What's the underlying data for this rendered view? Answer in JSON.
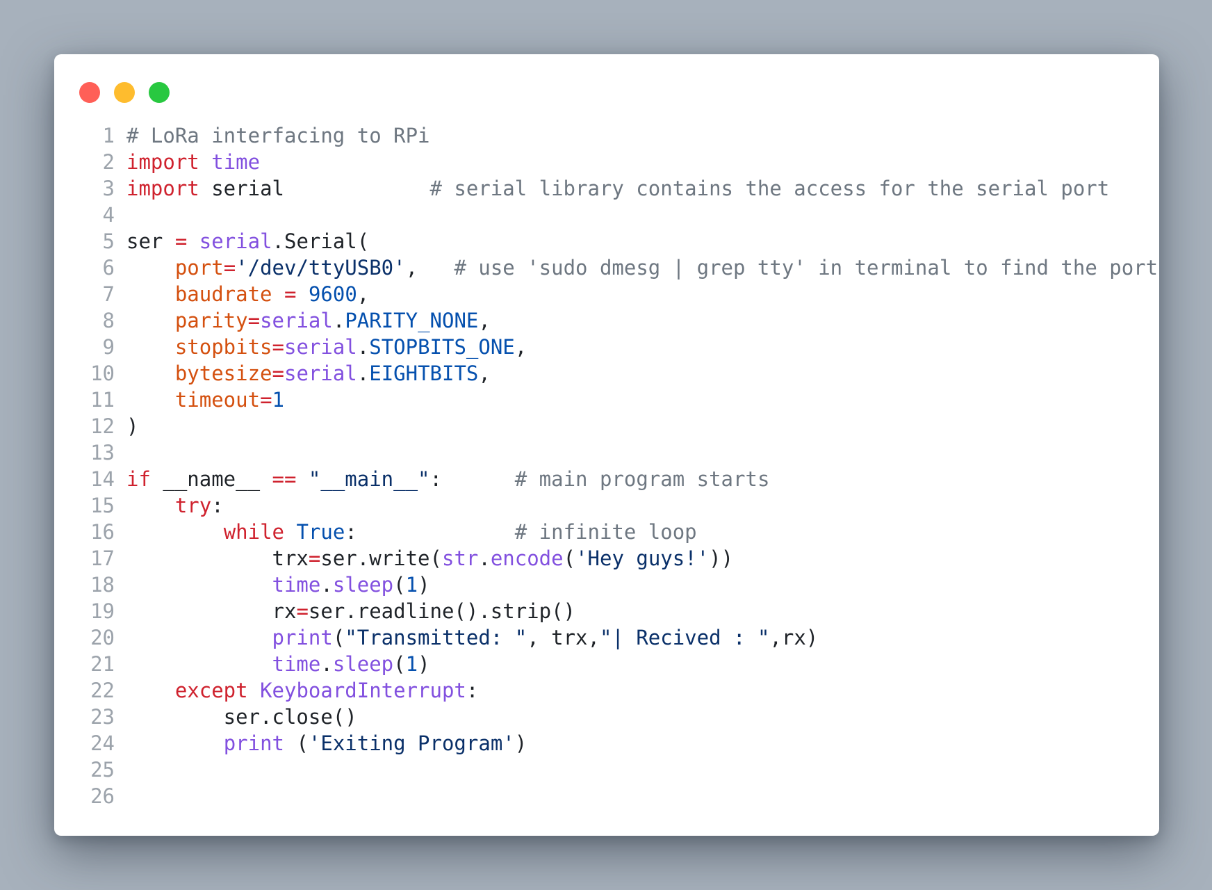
{
  "window": {
    "controls": [
      {
        "name": "close",
        "color": "#ff5f57"
      },
      {
        "name": "minimize",
        "color": "#febc2e"
      },
      {
        "name": "maximize",
        "color": "#28c840"
      }
    ]
  },
  "editor": {
    "lines": [
      {
        "n": "1",
        "tokens": [
          {
            "t": "# LoRa interfacing to RPi",
            "k": "comment"
          }
        ]
      },
      {
        "n": "2",
        "tokens": [
          {
            "t": "import",
            "k": "keyword"
          },
          {
            "t": " ",
            "k": "plain"
          },
          {
            "t": "time",
            "k": "builtin"
          }
        ]
      },
      {
        "n": "3",
        "tokens": [
          {
            "t": "import",
            "k": "keyword"
          },
          {
            "t": " serial            ",
            "k": "plain"
          },
          {
            "t": "# serial library contains the access for the serial port",
            "k": "comment"
          }
        ]
      },
      {
        "n": "4",
        "tokens": []
      },
      {
        "n": "5",
        "tokens": [
          {
            "t": "ser ",
            "k": "plain"
          },
          {
            "t": "=",
            "k": "op"
          },
          {
            "t": " ",
            "k": "plain"
          },
          {
            "t": "serial",
            "k": "builtin"
          },
          {
            "t": ".Serial(",
            "k": "plain"
          }
        ]
      },
      {
        "n": "6",
        "tokens": [
          {
            "t": "    ",
            "k": "plain"
          },
          {
            "t": "port",
            "k": "param"
          },
          {
            "t": "=",
            "k": "op"
          },
          {
            "t": "'/dev/ttyUSB0'",
            "k": "string"
          },
          {
            "t": ",   ",
            "k": "plain"
          },
          {
            "t": "# use 'sudo dmesg | grep tty' in terminal to find the port",
            "k": "comment"
          }
        ]
      },
      {
        "n": "7",
        "tokens": [
          {
            "t": "    ",
            "k": "plain"
          },
          {
            "t": "baudrate",
            "k": "param"
          },
          {
            "t": " ",
            "k": "plain"
          },
          {
            "t": "=",
            "k": "op"
          },
          {
            "t": " ",
            "k": "plain"
          },
          {
            "t": "9600",
            "k": "number"
          },
          {
            "t": ",",
            "k": "plain"
          }
        ]
      },
      {
        "n": "8",
        "tokens": [
          {
            "t": "    ",
            "k": "plain"
          },
          {
            "t": "parity",
            "k": "param"
          },
          {
            "t": "=",
            "k": "op"
          },
          {
            "t": "serial",
            "k": "builtin"
          },
          {
            "t": ".",
            "k": "plain"
          },
          {
            "t": "PARITY_NONE",
            "k": "const"
          },
          {
            "t": ",",
            "k": "plain"
          }
        ]
      },
      {
        "n": "9",
        "tokens": [
          {
            "t": "    ",
            "k": "plain"
          },
          {
            "t": "stopbits",
            "k": "param"
          },
          {
            "t": "=",
            "k": "op"
          },
          {
            "t": "serial",
            "k": "builtin"
          },
          {
            "t": ".",
            "k": "plain"
          },
          {
            "t": "STOPBITS_ONE",
            "k": "const"
          },
          {
            "t": ",",
            "k": "plain"
          }
        ]
      },
      {
        "n": "10",
        "tokens": [
          {
            "t": "    ",
            "k": "plain"
          },
          {
            "t": "bytesize",
            "k": "param"
          },
          {
            "t": "=",
            "k": "op"
          },
          {
            "t": "serial",
            "k": "builtin"
          },
          {
            "t": ".",
            "k": "plain"
          },
          {
            "t": "EIGHTBITS",
            "k": "const"
          },
          {
            "t": ",",
            "k": "plain"
          }
        ]
      },
      {
        "n": "11",
        "tokens": [
          {
            "t": "    ",
            "k": "plain"
          },
          {
            "t": "timeout",
            "k": "param"
          },
          {
            "t": "=",
            "k": "op"
          },
          {
            "t": "1",
            "k": "number"
          }
        ]
      },
      {
        "n": "12",
        "tokens": [
          {
            "t": ")",
            "k": "plain"
          }
        ]
      },
      {
        "n": "13",
        "tokens": []
      },
      {
        "n": "14",
        "tokens": [
          {
            "t": "if",
            "k": "keyword"
          },
          {
            "t": " __name__ ",
            "k": "plain"
          },
          {
            "t": "==",
            "k": "op"
          },
          {
            "t": " ",
            "k": "plain"
          },
          {
            "t": "\"__main__\"",
            "k": "string"
          },
          {
            "t": ":      ",
            "k": "plain"
          },
          {
            "t": "# main program starts",
            "k": "comment"
          }
        ]
      },
      {
        "n": "15",
        "tokens": [
          {
            "t": "    ",
            "k": "plain"
          },
          {
            "t": "try",
            "k": "keyword"
          },
          {
            "t": ":",
            "k": "plain"
          }
        ]
      },
      {
        "n": "16",
        "tokens": [
          {
            "t": "        ",
            "k": "plain"
          },
          {
            "t": "while",
            "k": "keyword"
          },
          {
            "t": " ",
            "k": "plain"
          },
          {
            "t": "True",
            "k": "const"
          },
          {
            "t": ":             ",
            "k": "plain"
          },
          {
            "t": "# infinite loop",
            "k": "comment"
          }
        ]
      },
      {
        "n": "17",
        "tokens": [
          {
            "t": "            trx",
            "k": "plain"
          },
          {
            "t": "=",
            "k": "op"
          },
          {
            "t": "ser.write(",
            "k": "plain"
          },
          {
            "t": "str",
            "k": "builtin"
          },
          {
            "t": ".",
            "k": "plain"
          },
          {
            "t": "encode",
            "k": "builtin"
          },
          {
            "t": "(",
            "k": "plain"
          },
          {
            "t": "'Hey guys!'",
            "k": "string"
          },
          {
            "t": "))",
            "k": "plain"
          }
        ]
      },
      {
        "n": "18",
        "tokens": [
          {
            "t": "            ",
            "k": "plain"
          },
          {
            "t": "time",
            "k": "builtin"
          },
          {
            "t": ".",
            "k": "plain"
          },
          {
            "t": "sleep",
            "k": "builtin"
          },
          {
            "t": "(",
            "k": "plain"
          },
          {
            "t": "1",
            "k": "number"
          },
          {
            "t": ")",
            "k": "plain"
          }
        ]
      },
      {
        "n": "19",
        "tokens": [
          {
            "t": "            rx",
            "k": "plain"
          },
          {
            "t": "=",
            "k": "op"
          },
          {
            "t": "ser.readline().strip()",
            "k": "plain"
          }
        ]
      },
      {
        "n": "20",
        "tokens": [
          {
            "t": "            ",
            "k": "plain"
          },
          {
            "t": "print",
            "k": "builtin"
          },
          {
            "t": "(",
            "k": "plain"
          },
          {
            "t": "\"Transmitted: \"",
            "k": "string"
          },
          {
            "t": ", trx,",
            "k": "plain"
          },
          {
            "t": "\"| Recived : \"",
            "k": "string"
          },
          {
            "t": ",rx)",
            "k": "plain"
          }
        ]
      },
      {
        "n": "21",
        "tokens": [
          {
            "t": "            ",
            "k": "plain"
          },
          {
            "t": "time",
            "k": "builtin"
          },
          {
            "t": ".",
            "k": "plain"
          },
          {
            "t": "sleep",
            "k": "builtin"
          },
          {
            "t": "(",
            "k": "plain"
          },
          {
            "t": "1",
            "k": "number"
          },
          {
            "t": ")",
            "k": "plain"
          }
        ]
      },
      {
        "n": "22",
        "tokens": [
          {
            "t": "    ",
            "k": "plain"
          },
          {
            "t": "except",
            "k": "keyword"
          },
          {
            "t": " ",
            "k": "plain"
          },
          {
            "t": "KeyboardInterrupt",
            "k": "builtin"
          },
          {
            "t": ":",
            "k": "plain"
          }
        ]
      },
      {
        "n": "23",
        "tokens": [
          {
            "t": "        ser.close()",
            "k": "plain"
          }
        ]
      },
      {
        "n": "24",
        "tokens": [
          {
            "t": "        ",
            "k": "plain"
          },
          {
            "t": "print",
            "k": "builtin"
          },
          {
            "t": " (",
            "k": "plain"
          },
          {
            "t": "'Exiting Program'",
            "k": "string"
          },
          {
            "t": ")",
            "k": "plain"
          }
        ]
      },
      {
        "n": "25",
        "tokens": []
      },
      {
        "n": "26",
        "tokens": []
      }
    ]
  }
}
